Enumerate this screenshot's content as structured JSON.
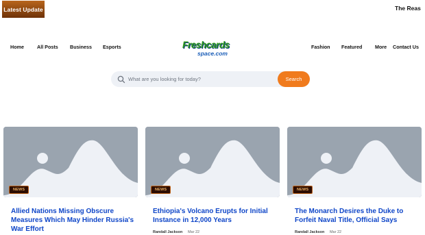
{
  "ticker": {
    "label": "Latest Update",
    "text": "The Reas"
  },
  "nav": {
    "home": "Home",
    "all_posts": "All Posts",
    "business": "Business",
    "esports": "Esports",
    "fashion": "Fashion",
    "featured": "Featured",
    "more": "More",
    "contact": "Contact Us"
  },
  "logo": {
    "top": "Freshcards",
    "bottom": "space.com"
  },
  "search": {
    "placeholder": "What are you looking for today?",
    "button": "Search"
  },
  "colors": {
    "accent": "#f07b1d",
    "title_link": "#0f46c8",
    "badge_bg": "#2d0d00",
    "placeholder_image": "#9aa4af"
  },
  "cards": [
    {
      "badge": "NEWS",
      "title": "Allied Nations Missing Obscure Measures Which May Hinder Russia's War Effort",
      "author": "",
      "date": ""
    },
    {
      "badge": "NEWS",
      "title": "Ethiopia's Volcano Erupts for Initial Instance in 12,000 Years",
      "author": "Randall Jackson",
      "date": "Mar 22"
    },
    {
      "badge": "NEWS",
      "title": "The Monarch Desires the Duke to Forfeit Naval Title, Official Says",
      "author": "Randall Jackson",
      "date": "Mar 22"
    }
  ]
}
